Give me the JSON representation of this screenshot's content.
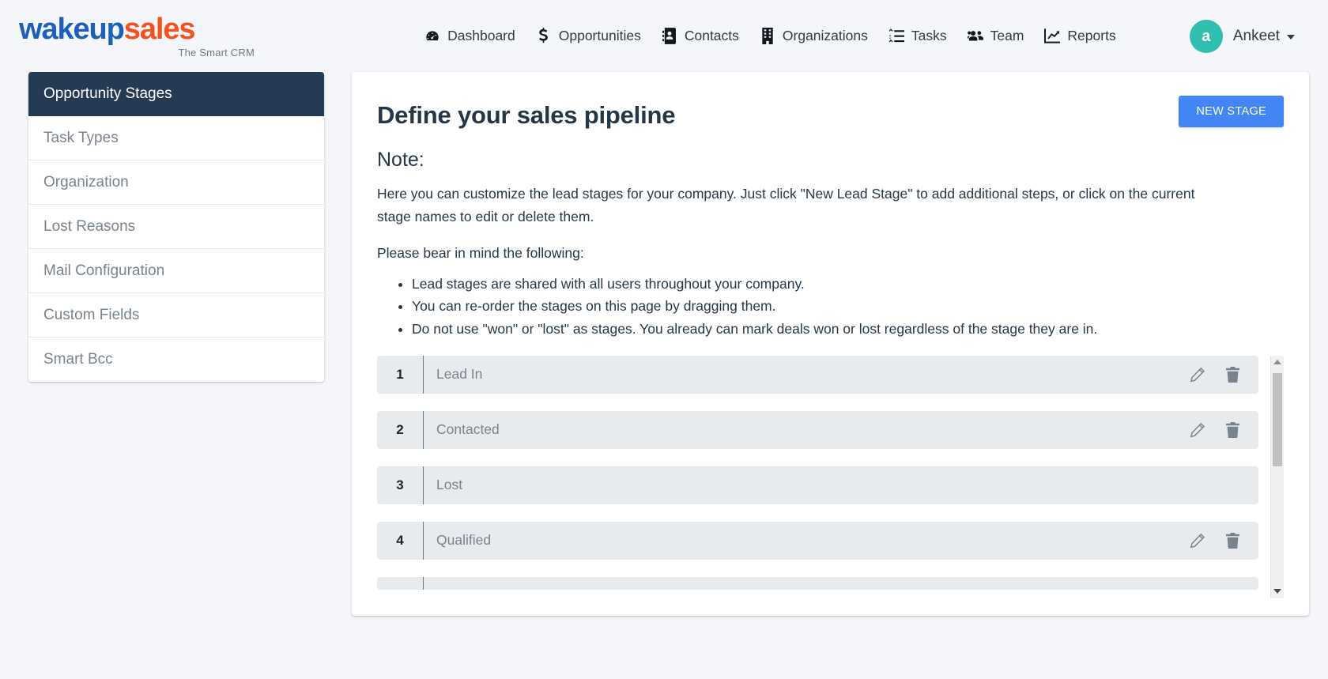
{
  "navbar": {
    "logo": {
      "part1": "wakeup",
      "part2": "sales",
      "tagline": "The Smart CRM",
      "color_part1": "#1b5fc1",
      "color_part2": "#f4511e"
    },
    "links": [
      {
        "label": "Dashboard",
        "icon": "dashboard-icon"
      },
      {
        "label": "Opportunities",
        "icon": "dollar-icon"
      },
      {
        "label": "Contacts",
        "icon": "address-book-icon"
      },
      {
        "label": "Organizations",
        "icon": "building-icon"
      },
      {
        "label": "Tasks",
        "icon": "tasks-list-icon"
      },
      {
        "label": "Team",
        "icon": "users-icon"
      },
      {
        "label": "Reports",
        "icon": "chart-line-icon"
      }
    ],
    "user": {
      "initial": "a",
      "name": "Ankeet",
      "avatar_color": "#2ebfaf",
      "caret": "chevron-down-icon"
    }
  },
  "sidebar": {
    "items": [
      {
        "label": "Opportunity Stages",
        "active": true
      },
      {
        "label": "Task Types",
        "active": false
      },
      {
        "label": "Organization",
        "active": false
      },
      {
        "label": "Lost Reasons",
        "active": false
      },
      {
        "label": "Mail Configuration",
        "active": false
      },
      {
        "label": "Custom Fields",
        "active": false
      },
      {
        "label": "Smart Bcc",
        "active": false
      }
    ],
    "active_color": "#243b53"
  },
  "main": {
    "title": "Define your sales pipeline",
    "new_stage_button": "NEW STAGE",
    "new_stage_button_color": "#4285f4",
    "note_label": "Note:",
    "note_paragraph": "Here you can customize the lead stages for your company. Just click \"New Lead Stage\" to add additional steps, or click on the current stage names to edit or delete them.",
    "note_subheading": "Please bear in mind the following:",
    "note_bullets": [
      "Lead stages are shared with all users throughout your company.",
      "You can re-order the stages on this page by dragging them.",
      "Do not use \"won\" or \"lost\" as stages. You already can mark deals won or lost regardless of the stage they are in."
    ],
    "stages": [
      {
        "number": "1",
        "name": "Lead In"
      },
      {
        "number": "2",
        "name": "Contacted"
      },
      {
        "number": "3",
        "name": "Lost"
      },
      {
        "number": "4",
        "name": "Qualified"
      }
    ],
    "stage_row_actions": {
      "edit_icon": "pencil-icon",
      "delete_icon": "trash-icon"
    },
    "scrollbar": {
      "up_arrow": "scroll-up-arrow-icon",
      "down_arrow": "scroll-down-arrow-icon"
    }
  }
}
